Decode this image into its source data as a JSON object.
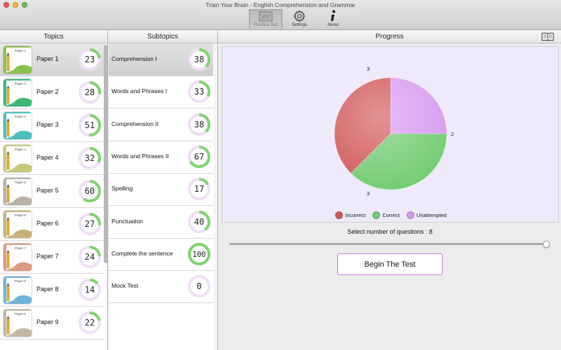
{
  "window": {
    "title": "Train Your Brain - English Comprehension and Grammar"
  },
  "toolbar": [
    {
      "label": "Practice Test",
      "icon": "practice-test-icon",
      "active": true
    },
    {
      "label": "Settings",
      "icon": "gear-icon",
      "active": false
    },
    {
      "label": "About",
      "icon": "info-icon",
      "active": false
    }
  ],
  "columns": {
    "topics": "Topics",
    "subtopics": "Subtopics",
    "progress": "Progress"
  },
  "topics": [
    {
      "label": "Paper 1",
      "thumb_text": "Paper 1",
      "score": "23",
      "fraction": 0.23,
      "color": "#8ac24a",
      "selected": true
    },
    {
      "label": "Paper 2",
      "thumb_text": "Paper 2",
      "score": "28",
      "fraction": 0.28,
      "color": "#3cb878"
    },
    {
      "label": "Paper 3",
      "thumb_text": "Paper 3",
      "score": "51",
      "fraction": 0.51,
      "color": "#4fbec0"
    },
    {
      "label": "Paper 4",
      "thumb_text": "Paper 4",
      "score": "32",
      "fraction": 0.32,
      "color": "#c8c87a"
    },
    {
      "label": "Paper 5",
      "thumb_text": "Paper 5",
      "score": "60",
      "fraction": 0.6,
      "color": "#b9b1a8"
    },
    {
      "label": "Paper 6",
      "thumb_text": "Paper 6",
      "score": "27",
      "fraction": 0.27,
      "color": "#c9b27a"
    },
    {
      "label": "Paper 7",
      "thumb_text": "Paper 7",
      "score": "24",
      "fraction": 0.24,
      "color": "#dd9a80"
    },
    {
      "label": "Paper 8",
      "thumb_text": "Paper 8",
      "score": "14",
      "fraction": 0.14,
      "color": "#6fb4d6"
    },
    {
      "label": "Paper 9",
      "thumb_text": "Paper 9",
      "score": "22",
      "fraction": 0.22,
      "color": "#c4b8a4"
    }
  ],
  "subtopics": [
    {
      "label": "Comprehension I",
      "score": "38",
      "fraction": 0.38,
      "selected": true
    },
    {
      "label": "Words and Phrases I",
      "score": "33",
      "fraction": 0.33
    },
    {
      "label": "Comprehension II",
      "score": "38",
      "fraction": 0.38
    },
    {
      "label": "Words and Phrases II",
      "score": "67",
      "fraction": 0.67
    },
    {
      "label": "Spelling",
      "score": "17",
      "fraction": 0.17
    },
    {
      "label": "Punctuation",
      "score": "40",
      "fraction": 0.4
    },
    {
      "label": "Complete the sentence",
      "score": "100",
      "fraction": 1.0
    },
    {
      "label": "Mock Test",
      "score": "0",
      "fraction": 0.0
    }
  ],
  "colors": {
    "ring_progress": "#7fd36b",
    "ring_track": "#eedff5",
    "incorrect": "#d25a5a",
    "correct": "#72cc72",
    "unattempted": "#d99bf0"
  },
  "chart_data": {
    "type": "pie",
    "title": "",
    "slices": [
      {
        "name": "Incorrect",
        "value": 3,
        "label": "3",
        "color": "#d25a5a"
      },
      {
        "name": "Correct",
        "value": 3,
        "label": "3",
        "color": "#72cc72"
      },
      {
        "name": "Unattempted",
        "value": 2,
        "label": "2",
        "color": "#d99bf0"
      }
    ],
    "legend": [
      "Incorrect",
      "Correct",
      "Unattempted"
    ],
    "legend_position": "bottom"
  },
  "progress": {
    "select_text": "Select number of questions : 8",
    "slider_value": 8,
    "slider_max": 8,
    "begin_label": "Begin The Test"
  }
}
